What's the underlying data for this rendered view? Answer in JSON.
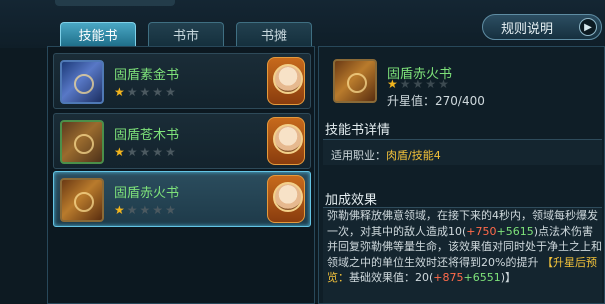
{
  "tabs": [
    {
      "label": "技能书",
      "active": true
    },
    {
      "label": "书市",
      "active": false
    },
    {
      "label": "书摊",
      "active": false
    }
  ],
  "rules_button": {
    "label": "规则说明",
    "arrow_icon": "chevron-right-icon"
  },
  "book_list": [
    {
      "name": "固盾素金书",
      "stars": 1,
      "max_stars": 5,
      "book_icon": "blue-book-icon"
    },
    {
      "name": "固盾苍木书",
      "stars": 1,
      "max_stars": 5,
      "book_icon": "green-book-icon"
    },
    {
      "name": "固盾赤火书",
      "stars": 1,
      "max_stars": 5,
      "book_icon": "red-book-icon",
      "selected": true
    }
  ],
  "selected": {
    "name": "固盾赤火书",
    "stars": 1,
    "upgrade_label": "升星值：",
    "upgrade_value": "270/400"
  },
  "details": {
    "title": "技能书详情",
    "job_label": "适用职业：",
    "job_value": "肉盾/技能4"
  },
  "bonus": {
    "title": "加成效果",
    "desc_1": "弥勒佛释放佛意领域，在接下来的4秒内，领域每秒爆发一次，对其中的敌人造成10(",
    "val_a": "+750",
    "val_b": "+5615",
    "desc_2": ")点法术伤害并回复弥勒佛等量生命，该效果值对同时处于净土之上和领域之中的单位生效时还将得到20%的提升",
    "preview_label": "【升星后预览：",
    "desc_3": "基础效果值：20(",
    "val_c": "+875",
    "val_d": "+6551",
    "desc_4": ")】"
  },
  "colors": {
    "name_green": "#7ee27a",
    "star_gold": "#f2b51e",
    "accent_blue": "#64c4e4",
    "value_red": "#ff6a4a",
    "highlight_yellow": "#f3c23a"
  }
}
